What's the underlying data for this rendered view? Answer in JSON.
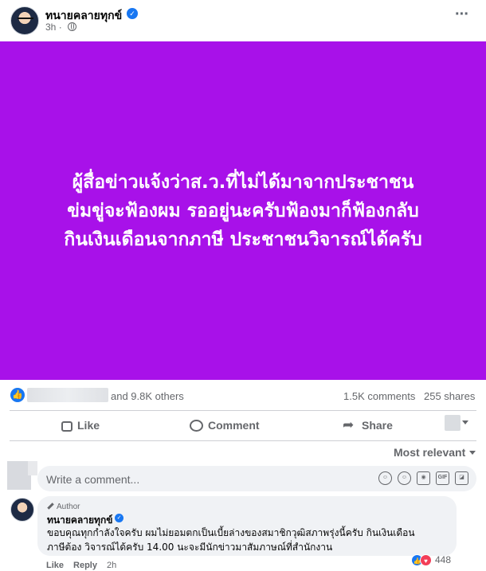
{
  "post": {
    "author": "ทนายคลายทุกข์",
    "time": "3h",
    "text": "ผู้สื่อข่าวแจ้งว่าส.ว.ที่ไม่ได้มาจากประชาชน\nข่มขู่จะฟ้องผม รออยู่นะครับฟ้องมาก็ฟ้องกลับ\nกินเงินเดือนจากภาษี ประชาชนวิจารณ์ได้ครับ",
    "background_color": "#a811e9",
    "icons": {
      "verified": "verified-badge-icon",
      "audience": "globe-icon",
      "menu": "more-horizontal-icon"
    }
  },
  "stats": {
    "reactions_text": "and 9.8K others",
    "comments": "1.5K comments",
    "shares": "255 shares"
  },
  "actions": {
    "like": "Like",
    "comment": "Comment",
    "share": "Share"
  },
  "comments_section": {
    "sort_label": "Most relevant",
    "input_placeholder": "Write a comment...",
    "input_icons": [
      "avatar-sticker-icon",
      "emoji-icon",
      "camera-icon",
      "gif-icon",
      "sticker-icon"
    ]
  },
  "top_comment": {
    "badge": "Author",
    "author": "ทนายคลายทุกข์",
    "text": "ขอบคุณทุกกำลังใจครับ ผมไม่ยอมตกเป็นเบี้ยล่างของสมาชิกวุฒิสภาพรุ่งนี้ครับ กินเงินเดือน\nภาษีต้อง วิจารณ์ได้ครับ 14.00 นะจะมีนักข่าวมาสัมภาษณ์ที่สำนักงาน",
    "like_label": "Like",
    "reply_label": "Reply",
    "time": "2h",
    "reaction_count": "448"
  },
  "colors": {
    "brand_blue": "#1877f2",
    "love_red": "#f33e58",
    "secondary_text": "#65676b"
  }
}
